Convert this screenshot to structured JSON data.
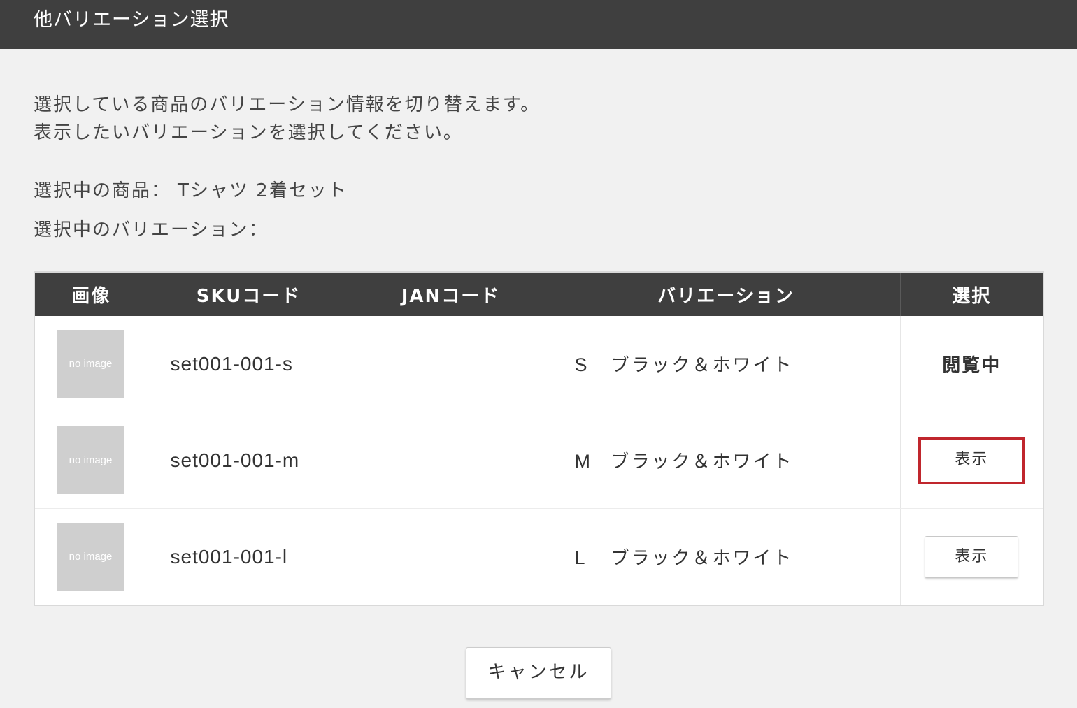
{
  "dialog": {
    "title": "他バリエーション選択"
  },
  "description": {
    "line1": "選択している商品のバリエーション情報を切り替えます。",
    "line2": "表示したいバリエーションを選択してください。"
  },
  "selection": {
    "product_label": "選択中の商品：",
    "product_value": "Tシャツ 2着セット",
    "variation_label": "選択中のバリエーション：",
    "variation_value": ""
  },
  "table": {
    "headers": {
      "image": "画像",
      "sku": "SKUコード",
      "jan": "JANコード",
      "variation": "バリエーション",
      "select": "選択"
    },
    "rows": [
      {
        "image_placeholder": "no image",
        "sku": "set001-001-s",
        "jan": "",
        "size": "S",
        "color": "ブラック＆ホワイト",
        "select_text": "閲覧中"
      },
      {
        "image_placeholder": "no image",
        "sku": "set001-001-m",
        "jan": "",
        "size": "M",
        "color": "ブラック＆ホワイト",
        "select_text": "表示"
      },
      {
        "image_placeholder": "no image",
        "sku": "set001-001-l",
        "jan": "",
        "size": "L",
        "color": "ブラック＆ホワイト",
        "select_text": "表示"
      }
    ]
  },
  "footer": {
    "cancel_label": "キャンセル"
  },
  "colors": {
    "header_bg": "#3f3f3f",
    "page_bg": "#f1f1f1",
    "highlight": "#c0262d",
    "placeholder": "#cfcfcf"
  }
}
